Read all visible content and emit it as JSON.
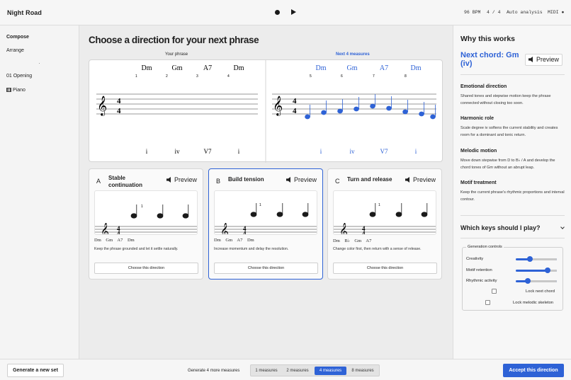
{
  "app": {
    "title": "Night Road"
  },
  "status": {
    "bpm": "96 BPM",
    "meter": "4 / 4",
    "analysis": "Auto analysis",
    "midi": "MIDI ●"
  },
  "sidebar": {
    "compose": "Compose",
    "arrange": "Arrange",
    "section": "01 Opening",
    "instrument": "Piano"
  },
  "main": {
    "title": "Choose a direction for your next phrase",
    "your_phrase_label": "Your phrase",
    "next_label": "Next 4 measures"
  },
  "score": {
    "your_chords": [
      "Dm",
      "Gm",
      "A7",
      "Dm"
    ],
    "next_chords": [
      "Dm",
      "Gm",
      "A7",
      "Dm"
    ],
    "your_measure_numbers": [
      "1",
      "2",
      "3",
      "4"
    ],
    "next_measure_numbers": [
      "5",
      "6",
      "7",
      "8"
    ],
    "your_romans": [
      "i",
      "iv",
      "V7",
      "i"
    ],
    "next_romans": [
      "i",
      "iv",
      "V7",
      "i"
    ],
    "time_signature_top": "4",
    "time_signature_bottom": "4",
    "clef": "𝄞",
    "accent_color": "#2e62d6"
  },
  "cards": [
    {
      "letter": "A",
      "title": "Stable continuation",
      "preview": "Preview",
      "measure_number": "1",
      "time_top": "4",
      "time_bottom": "4",
      "chords": "Dm  Gm  A7  Dm",
      "description": "Keep the phrase grounded and let it settle naturally.",
      "choose": "Choose this direction"
    },
    {
      "letter": "B",
      "title": "Build tension",
      "preview": "Preview",
      "measure_number": "1",
      "time_top": "4",
      "time_bottom": "4",
      "chords": "Dm  Gm  A7  Dm",
      "description": "Increase momentum and delay the resolution.",
      "choose": "Choose this direction"
    },
    {
      "letter": "C",
      "title": "Turn and release",
      "preview": "Preview",
      "measure_number": "1",
      "time_top": "4",
      "time_bottom": "4",
      "chords": "Dm  B♭  Gm  A7",
      "description": "Change color first, then return with a sense of release.",
      "choose": "Choose this direction"
    }
  ],
  "right": {
    "why_title": "Why this works",
    "next_chord": "Next chord: Gm (iv)",
    "preview": "Preview",
    "sections": [
      {
        "title": "Emotional direction",
        "text": "Shared tones and stepwise motion keep the phrase connected without closing too soon."
      },
      {
        "title": "Harmonic role",
        "text": "Scale degree iv softens the current stability and creates room for a dominant and tonic return."
      },
      {
        "title": "Melodic motion",
        "text": "Move down stepwise from D to B♭ / A and develop the chord tones of Gm without an abrupt leap."
      },
      {
        "title": "Motif treatment",
        "text": "Keep the current phrase's rhythmic proportions and interval contour."
      }
    ],
    "keys_title": "Which keys should I play?",
    "generation": {
      "legend": "Generation controls",
      "sliders": [
        {
          "label": "Creativity",
          "value": 0.35
        },
        {
          "label": "Motif retention",
          "value": 0.78
        },
        {
          "label": "Rhythmic activity",
          "value": 0.3
        }
      ],
      "lock_next_chord": "Lock next chord",
      "lock_melodic_skeleton": "Lock melodic skeleton"
    }
  },
  "bottom": {
    "generate_set": "Generate a new set",
    "generate_more": "Generate 4 more measures",
    "options": [
      "1 measures",
      "2 measures",
      "4 measures",
      "8 measures"
    ],
    "selected_option": "4 measures",
    "accept": "Accept this direction"
  }
}
